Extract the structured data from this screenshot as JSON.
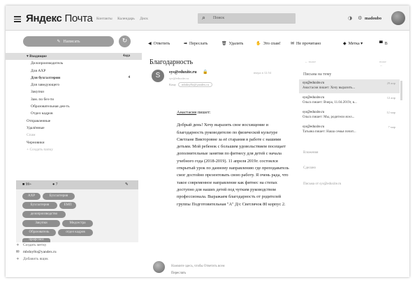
{
  "header": {
    "logo": "Яндекс",
    "logo_suffix": "Почта",
    "nav": [
      "Контакты",
      "Календарь",
      "Диск"
    ],
    "search_placeholder": "Поиск",
    "user_login": "madoubo"
  },
  "sidebar": {
    "write_label": "Написать",
    "folders": [
      {
        "label": "▾ Входящие",
        "count": "4ада",
        "active": true,
        "indent": 1
      },
      {
        "label": "Делопроизводитель",
        "indent": 2
      },
      {
        "label": "Для АХР",
        "indent": 2
      },
      {
        "label": "Для бухгалтерии",
        "count": "4",
        "bold": true,
        "indent": 2
      },
      {
        "label": "Для заведующего",
        "indent": 2
      },
      {
        "label": "Закупки",
        "indent": 2
      },
      {
        "label": "Зам. по без-ти",
        "indent": 2
      },
      {
        "label": "Образовательная дея-ть",
        "indent": 2
      },
      {
        "label": "Отдел кадров",
        "indent": 2
      },
      {
        "label": "Отправленные",
        "indent": 1
      },
      {
        "label": "Удалённые",
        "indent": 1
      },
      {
        "label": "Спам",
        "indent": 1,
        "dim": true
      },
      {
        "label": "Черновики",
        "indent": 1
      },
      {
        "label": "+  Создать папку",
        "indent": 1,
        "dim": true
      }
    ],
    "label_panel_tabs": [
      "■ 99+",
      "● 7",
      "✎"
    ],
    "labels": [
      "АХР",
      "Бухгалтерия",
      "Бухгалтерия",
      "ЕМП",
      "делопроизводство",
      "Закупки",
      "Медсестра",
      "Образователь",
      "отдел кадров",
      "профсоюз"
    ],
    "footer_create_label": "Создать метку",
    "footer_email": "mbdoy8o@yandex.ru",
    "footer_add_mailbox": "Добавить ящик"
  },
  "toolbar": {
    "reply": "Ответить",
    "forward": "Переслать",
    "delete": "Удалить",
    "spam": "Это спам!",
    "unread": "Не прочитано",
    "label": "Метка",
    "folder": "В"
  },
  "message": {
    "subject": "Благодарность",
    "avatar_letter": "S",
    "sender": "sys@eduxite.ru",
    "sender_sub": "sys@eduxite.ru",
    "date": "вчера в 12:54",
    "to_label": "Кому",
    "to_value": "mbdoy8o@yandex.ru",
    "intro_name": "Анастасия",
    "intro_rest": " пишет:",
    "body": "Добрый день! Хочу выразить свое восхищение и благодарность руководителю по физической культуре Светлане Викторовне за её старания в работе с нашими детьми. Мой ребенок с большим удовольствием посещает дополнительные занятия по фитнесу для детей с начала учебного года (2018-2019). 11 апреля 2019г. состоялся открытый урок по данному направлению где преподаватель смог достойно презентовать свою работу. Я очень рада, что такое современное направление как фитнес на степах доступно для наших детей под чутким руководством профессионала. Выражаем благодарность от родителей группы Подготовительная \"А\" Д/с Светлячок 80 корпус 2.",
    "reply_hint": "Нажмите здесь, чтобы Ответить всем",
    "forward_link": "Переслать"
  },
  "thread": {
    "nav_left": "← выше",
    "nav_right": "ниже →",
    "heading": "Письма на тему",
    "items": [
      {
        "from": "sys@eduxite.ru",
        "date": "29 апр",
        "snippet": "Анастасия пишет: Хочу выразить...",
        "selected": true
      },
      {
        "from": "sys@eduxite.ru",
        "date": "12 апр",
        "snippet": "Ольга пишет: Вчера, 11.04.2019г, в..."
      },
      {
        "from": "sys@eduxite.ru",
        "date": "12 мар",
        "snippet": "Ольга пишет: Мы, родители ясел..."
      },
      {
        "from": "sys@eduxite.ru",
        "date": "7 мар",
        "snippet": "Татьяна пишет: Наша семья почит..."
      }
    ],
    "attachments_label": "Вложения",
    "contacts_label": "Сделано",
    "from_sender_label": "Письма от sys@eduxite.ru"
  }
}
